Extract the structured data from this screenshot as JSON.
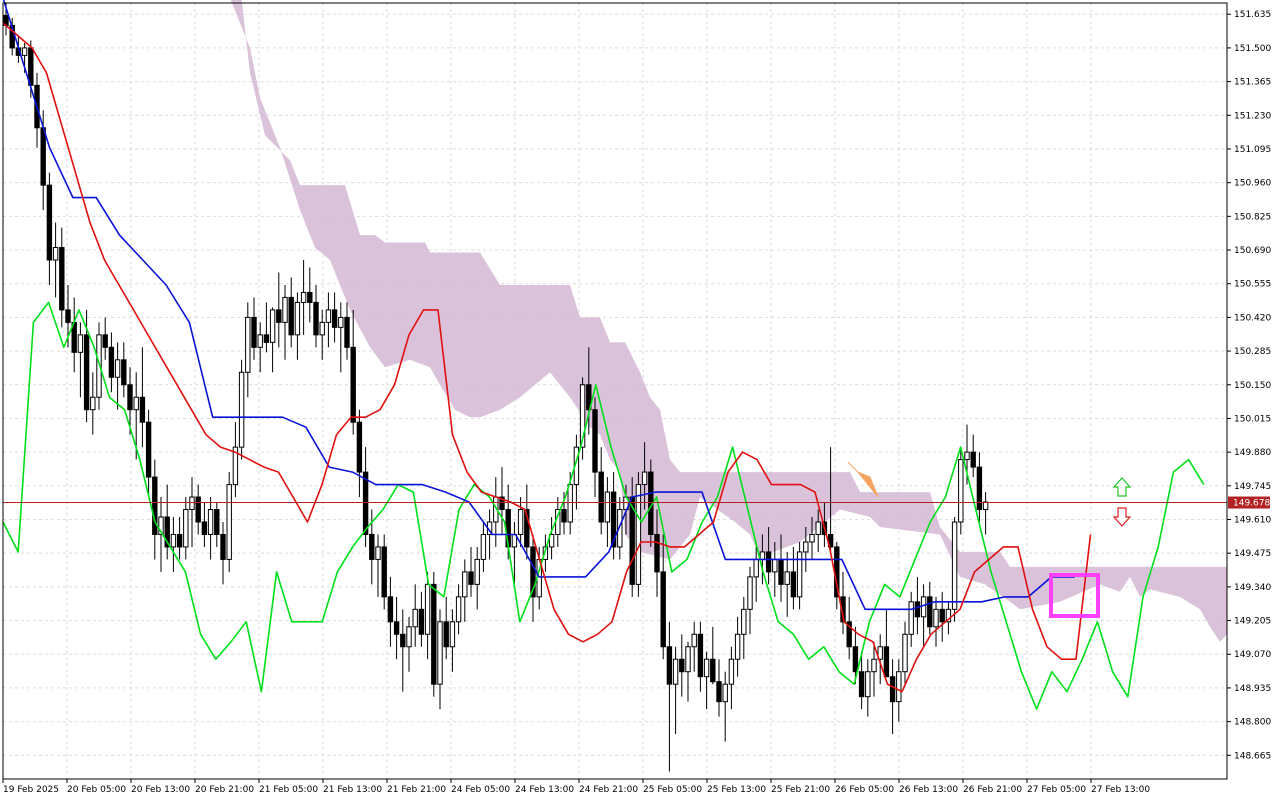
{
  "chart_data": {
    "type": "candlestick",
    "indicator": "Ichimoku Kinko Hyo",
    "y_ticks": [
      "151.635",
      "151.500",
      "151.365",
      "151.230",
      "151.095",
      "150.960",
      "150.825",
      "150.690",
      "150.555",
      "150.420",
      "150.285",
      "150.150",
      "150.015",
      "149.880",
      "149.745",
      "149.610",
      "149.475",
      "149.340",
      "149.205",
      "149.070",
      "148.935",
      "148.800",
      "148.665"
    ],
    "ylim": [
      148.57,
      151.68
    ],
    "x_ticks": [
      "19 Feb 2025",
      "20 Feb 05:00",
      "20 Feb 13:00",
      "20 Feb 21:00",
      "21 Feb 05:00",
      "21 Feb 13:00",
      "21 Feb 21:00",
      "24 Feb 05:00",
      "24 Feb 13:00",
      "24 Feb 21:00",
      "25 Feb 05:00",
      "25 Feb 13:00",
      "25 Feb 21:00",
      "26 Feb 05:00",
      "26 Feb 13:00",
      "26 Feb 21:00",
      "27 Feb 05:00",
      "27 Feb 13:00"
    ],
    "current_price": "149.678",
    "bar_spacing": "1 hour",
    "grid": true,
    "candles": [
      [
        151.63,
        151.68,
        151.55,
        151.59
      ],
      [
        151.59,
        151.62,
        151.47,
        151.5
      ],
      [
        151.5,
        151.55,
        151.44,
        151.47
      ],
      [
        151.47,
        151.52,
        151.4,
        151.5
      ],
      [
        151.5,
        151.53,
        151.3,
        151.35
      ],
      [
        151.35,
        151.4,
        151.1,
        151.18
      ],
      [
        151.18,
        151.25,
        150.85,
        150.95
      ],
      [
        150.95,
        151.0,
        150.55,
        150.65
      ],
      [
        150.65,
        150.8,
        150.5,
        150.7
      ],
      [
        150.7,
        150.78,
        150.38,
        150.45
      ],
      [
        150.45,
        150.55,
        150.3,
        150.4
      ],
      [
        150.4,
        150.5,
        150.2,
        150.28
      ],
      [
        150.28,
        150.4,
        150.1,
        150.35
      ],
      [
        150.35,
        150.45,
        150.0,
        150.05
      ],
      [
        150.05,
        150.2,
        149.95,
        150.1
      ],
      [
        150.1,
        150.4,
        150.05,
        150.35
      ],
      [
        150.35,
        150.42,
        150.25,
        150.3
      ],
      [
        150.3,
        150.36,
        150.12,
        150.18
      ],
      [
        150.18,
        150.32,
        150.05,
        150.25
      ],
      [
        150.25,
        150.32,
        150.1,
        150.15
      ],
      [
        150.15,
        150.22,
        149.95,
        150.05
      ],
      [
        150.05,
        150.2,
        149.85,
        150.1
      ],
      [
        150.1,
        150.3,
        149.9,
        150.0
      ],
      [
        150.0,
        150.05,
        149.7,
        149.78
      ],
      [
        149.78,
        149.85,
        149.45,
        149.55
      ],
      [
        149.55,
        149.7,
        149.4,
        149.62
      ],
      [
        149.62,
        149.75,
        149.45,
        149.5
      ],
      [
        149.5,
        149.62,
        149.4,
        149.55
      ],
      [
        149.55,
        149.62,
        149.45,
        149.5
      ],
      [
        149.5,
        149.7,
        149.45,
        149.65
      ],
      [
        149.65,
        149.78,
        149.5,
        149.7
      ],
      [
        149.7,
        149.75,
        149.55,
        149.6
      ],
      [
        149.6,
        149.68,
        149.5,
        149.55
      ],
      [
        149.55,
        149.7,
        149.45,
        149.65
      ],
      [
        149.65,
        149.68,
        149.5,
        149.55
      ],
      [
        149.55,
        149.6,
        149.35,
        149.45
      ],
      [
        149.45,
        149.8,
        149.4,
        149.75
      ],
      [
        149.75,
        150.0,
        149.7,
        149.9
      ],
      [
        149.9,
        150.25,
        149.85,
        150.2
      ],
      [
        150.2,
        150.48,
        150.1,
        150.42
      ],
      [
        150.42,
        150.5,
        150.25,
        150.3
      ],
      [
        150.3,
        150.4,
        150.2,
        150.35
      ],
      [
        150.35,
        150.48,
        150.28,
        150.32
      ],
      [
        150.32,
        150.46,
        150.2,
        150.45
      ],
      [
        150.45,
        150.6,
        150.3,
        150.4
      ],
      [
        150.4,
        150.55,
        150.25,
        150.5
      ],
      [
        150.5,
        150.58,
        150.3,
        150.35
      ],
      [
        150.35,
        150.52,
        150.25,
        150.48
      ],
      [
        150.48,
        150.65,
        150.35,
        150.52
      ],
      [
        150.52,
        150.62,
        150.4,
        150.48
      ],
      [
        150.48,
        150.55,
        150.3,
        150.35
      ],
      [
        150.35,
        150.45,
        150.25,
        150.4
      ],
      [
        150.4,
        150.52,
        150.3,
        150.45
      ],
      [
        150.45,
        150.52,
        150.32,
        150.38
      ],
      [
        150.38,
        150.48,
        150.2,
        150.42
      ],
      [
        150.42,
        150.48,
        150.25,
        150.3
      ],
      [
        150.3,
        150.45,
        149.95,
        150.0
      ],
      [
        150.0,
        150.05,
        149.7,
        149.8
      ],
      [
        149.8,
        149.9,
        149.5,
        149.55
      ],
      [
        149.55,
        149.65,
        149.35,
        149.45
      ],
      [
        149.45,
        149.55,
        149.3,
        149.5
      ],
      [
        149.5,
        149.55,
        149.25,
        149.3
      ],
      [
        149.3,
        149.38,
        149.1,
        149.2
      ],
      [
        149.2,
        149.3,
        149.05,
        149.15
      ],
      [
        149.15,
        149.25,
        148.92,
        149.1
      ],
      [
        149.1,
        149.22,
        149.0,
        149.18
      ],
      [
        149.18,
        149.35,
        149.1,
        149.25
      ],
      [
        149.25,
        149.32,
        149.1,
        149.15
      ],
      [
        149.15,
        149.4,
        149.05,
        149.35
      ],
      [
        149.35,
        149.4,
        148.9,
        148.95
      ],
      [
        148.95,
        149.25,
        148.85,
        149.2
      ],
      [
        149.2,
        149.3,
        149.05,
        149.1
      ],
      [
        149.1,
        149.25,
        149.0,
        149.2
      ],
      [
        149.2,
        149.35,
        149.15,
        149.3
      ],
      [
        149.3,
        149.45,
        149.2,
        149.4
      ],
      [
        149.4,
        149.5,
        149.3,
        149.35
      ],
      [
        149.35,
        149.5,
        149.25,
        149.45
      ],
      [
        149.45,
        149.6,
        149.4,
        149.55
      ],
      [
        149.55,
        149.65,
        149.45,
        149.6
      ],
      [
        149.6,
        149.78,
        149.5,
        149.7
      ],
      [
        149.7,
        149.82,
        149.55,
        149.65
      ],
      [
        149.65,
        149.75,
        149.45,
        149.5
      ],
      [
        149.5,
        149.6,
        149.35,
        149.55
      ],
      [
        149.55,
        149.7,
        149.5,
        149.65
      ],
      [
        149.65,
        149.75,
        149.45,
        149.5
      ],
      [
        149.5,
        149.55,
        149.2,
        149.3
      ],
      [
        149.3,
        149.5,
        149.25,
        149.45
      ],
      [
        149.45,
        149.55,
        149.4,
        149.5
      ],
      [
        149.5,
        149.62,
        149.45,
        149.55
      ],
      [
        149.55,
        149.7,
        149.5,
        149.65
      ],
      [
        149.65,
        149.72,
        149.55,
        149.6
      ],
      [
        149.6,
        149.8,
        149.55,
        149.75
      ],
      [
        149.75,
        149.95,
        149.65,
        149.9
      ],
      [
        149.9,
        150.18,
        149.85,
        150.15
      ],
      [
        150.15,
        150.3,
        149.95,
        150.05
      ],
      [
        150.05,
        150.1,
        149.7,
        149.8
      ],
      [
        149.8,
        149.9,
        149.55,
        149.6
      ],
      [
        149.6,
        149.78,
        149.5,
        149.72
      ],
      [
        149.72,
        149.8,
        149.45,
        149.5
      ],
      [
        149.5,
        149.7,
        149.45,
        149.65
      ],
      [
        149.65,
        149.75,
        149.55,
        149.7
      ],
      [
        149.7,
        149.78,
        149.3,
        149.35
      ],
      [
        149.35,
        149.8,
        149.3,
        149.75
      ],
      [
        149.75,
        149.92,
        149.65,
        149.8
      ],
      [
        149.8,
        149.85,
        149.5,
        149.55
      ],
      [
        149.55,
        149.65,
        149.3,
        149.4
      ],
      [
        149.4,
        149.55,
        149.05,
        149.1
      ],
      [
        149.1,
        149.2,
        148.6,
        148.95
      ],
      [
        148.95,
        149.1,
        148.75,
        149.05
      ],
      [
        149.05,
        149.15,
        148.9,
        149.0
      ],
      [
        149.0,
        149.12,
        148.88,
        149.1
      ],
      [
        149.1,
        149.2,
        149.0,
        149.15
      ],
      [
        149.15,
        149.2,
        148.92,
        148.98
      ],
      [
        148.98,
        149.08,
        148.85,
        149.05
      ],
      [
        149.05,
        149.18,
        148.95,
        148.96
      ],
      [
        148.96,
        149.05,
        148.82,
        148.88
      ],
      [
        148.88,
        149.0,
        148.72,
        148.95
      ],
      [
        148.95,
        149.1,
        148.85,
        149.05
      ],
      [
        149.05,
        149.22,
        148.98,
        149.15
      ],
      [
        149.15,
        149.3,
        149.05,
        149.25
      ],
      [
        149.25,
        149.42,
        149.15,
        149.38
      ],
      [
        149.38,
        149.5,
        149.28,
        149.45
      ],
      [
        149.45,
        149.55,
        149.35,
        149.48
      ],
      [
        149.48,
        149.58,
        149.35,
        149.4
      ],
      [
        149.4,
        149.52,
        149.3,
        149.45
      ],
      [
        149.45,
        149.55,
        149.28,
        149.35
      ],
      [
        149.35,
        149.48,
        149.22,
        149.4
      ],
      [
        149.4,
        149.5,
        149.25,
        149.3
      ],
      [
        149.3,
        149.52,
        149.25,
        149.48
      ],
      [
        149.48,
        149.58,
        149.4,
        149.52
      ],
      [
        149.52,
        149.62,
        149.45,
        149.55
      ],
      [
        149.55,
        149.65,
        149.48,
        149.6
      ],
      [
        149.6,
        149.68,
        149.5,
        149.55
      ],
      [
        149.55,
        149.9,
        149.48,
        149.5
      ],
      [
        149.5,
        149.52,
        149.25,
        149.3
      ],
      [
        149.3,
        149.4,
        149.15,
        149.2
      ],
      [
        149.2,
        149.3,
        149.05,
        149.1
      ],
      [
        149.1,
        149.18,
        148.95,
        149.0
      ],
      [
        149.0,
        149.08,
        148.85,
        148.9
      ],
      [
        148.9,
        149.05,
        148.82,
        149.0
      ],
      [
        149.0,
        149.12,
        148.9,
        149.05
      ],
      [
        149.05,
        149.15,
        148.95,
        149.1
      ],
      [
        149.1,
        149.25,
        149.0,
        148.98
      ],
      [
        148.98,
        149.05,
        148.75,
        148.88
      ],
      [
        148.88,
        149.05,
        148.8,
        149.0
      ],
      [
        149.0,
        149.2,
        148.95,
        149.15
      ],
      [
        149.15,
        149.32,
        149.1,
        149.28
      ],
      [
        149.28,
        149.38,
        149.15,
        149.22
      ],
      [
        149.22,
        149.35,
        149.1,
        149.3
      ],
      [
        149.3,
        149.36,
        149.15,
        149.18
      ],
      [
        149.18,
        149.3,
        149.1,
        149.25
      ],
      [
        149.25,
        149.32,
        149.12,
        149.2
      ],
      [
        149.2,
        149.28,
        149.15,
        149.25
      ],
      [
        149.25,
        149.62,
        149.2,
        149.6
      ],
      [
        149.6,
        149.9,
        149.55,
        149.85
      ],
      [
        149.85,
        149.99,
        149.75,
        149.88
      ],
      [
        149.88,
        149.95,
        149.78,
        149.82
      ],
      [
        149.82,
        149.88,
        149.6,
        149.65
      ],
      [
        149.65,
        149.72,
        149.55,
        149.68
      ]
    ],
    "tenkan_sen": [
      151.6,
      151.55,
      151.5,
      151.4,
      151.2,
      151.0,
      150.8,
      150.65,
      150.55,
      150.45,
      150.35,
      150.25,
      150.15,
      150.05,
      149.95,
      149.9,
      149.88,
      149.85,
      149.82,
      149.8,
      149.7,
      149.6,
      149.75,
      149.95,
      150.02,
      150.02,
      150.05,
      150.15,
      150.35,
      150.45,
      150.45,
      149.95,
      149.8,
      149.72,
      149.7,
      149.68,
      149.65,
      149.45,
      149.25,
      149.15,
      149.12,
      149.15,
      149.2,
      149.4,
      149.52,
      149.52,
      149.5,
      149.5,
      149.55,
      149.6,
      149.8,
      149.88,
      149.85,
      149.75,
      149.75,
      149.75,
      149.72,
      149.5,
      149.2,
      149.15,
      149.12,
      148.95,
      148.92,
      149.05,
      149.15,
      149.2,
      149.25,
      149.4,
      149.45,
      149.5,
      149.5,
      149.25,
      149.1,
      149.05,
      149.05,
      149.55
    ],
    "kijun_sen": [
      151.7,
      151.4,
      151.1,
      150.9,
      150.9,
      150.75,
      150.65,
      150.55,
      150.4,
      150.02,
      150.02,
      150.02,
      150.02,
      149.98,
      149.82,
      149.8,
      149.75,
      149.75,
      149.75,
      149.72,
      149.68,
      149.55,
      149.55,
      149.38,
      149.38,
      149.38,
      149.48,
      149.7,
      149.72,
      149.72,
      149.72,
      149.45,
      149.45,
      149.45,
      149.45,
      149.45,
      149.45,
      149.25,
      149.25,
      149.25,
      149.28,
      149.28,
      149.28,
      149.3,
      149.3,
      149.38,
      149.38
    ],
    "chikou_span": [
      149.6,
      149.48,
      150.4,
      150.48,
      150.3,
      150.45,
      150.3,
      150.1,
      150.05,
      149.85,
      149.6,
      149.5,
      149.4,
      149.15,
      149.05,
      149.12,
      149.2,
      148.92,
      149.4,
      149.2,
      149.2,
      149.2,
      149.4,
      149.5,
      149.58,
      149.65,
      149.75,
      149.72,
      149.35,
      149.3,
      149.65,
      149.75,
      149.7,
      149.6,
      149.2,
      149.35,
      149.55,
      149.7,
      149.9,
      150.15,
      149.9,
      149.7,
      149.6,
      149.7,
      149.4,
      149.45,
      149.6,
      149.7,
      149.9,
      149.65,
      149.4,
      149.2,
      149.15,
      149.05,
      149.1,
      149.0,
      148.95,
      149.2,
      149.35,
      149.3,
      149.45,
      149.6,
      149.7,
      149.9,
      149.65,
      149.4,
      149.2,
      149.0,
      148.85,
      149.0,
      148.92,
      149.05,
      149.2,
      149.0,
      148.9,
      149.3,
      149.5,
      149.8,
      149.85,
      149.75
    ]
  }
}
